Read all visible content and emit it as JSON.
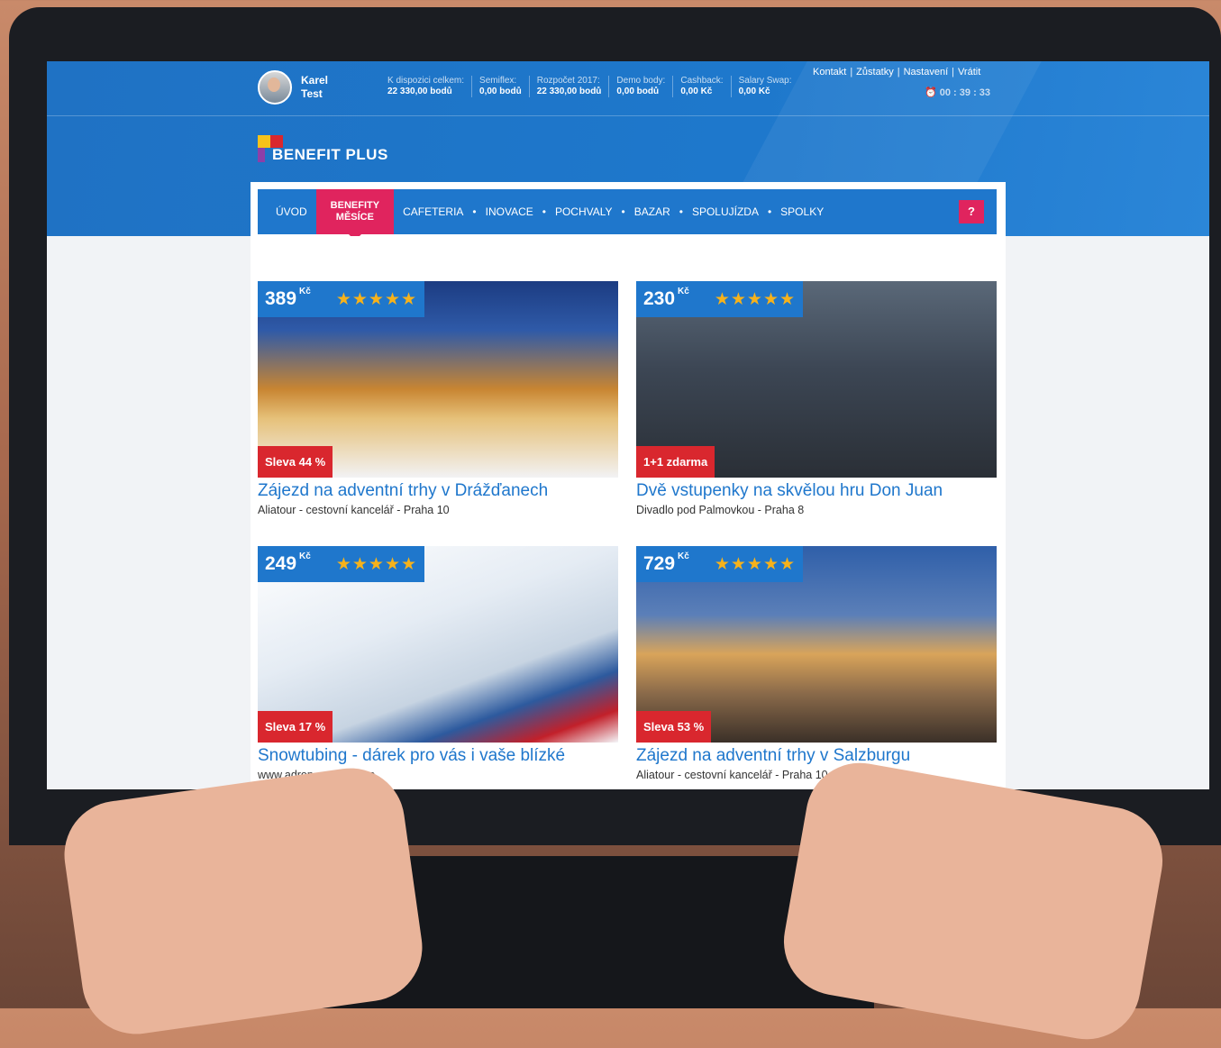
{
  "user": {
    "first_name": "Karel",
    "last_name": "Test"
  },
  "stats": [
    {
      "label": "K dispozici celkem:",
      "value": "22 330,00 bodů"
    },
    {
      "label": "Semiflex:",
      "value": "0,00 bodů"
    },
    {
      "label": "Rozpočet 2017:",
      "value": "22 330,00 bodů"
    },
    {
      "label": "Demo body:",
      "value": "0,00 bodů"
    },
    {
      "label": "Cashback:",
      "value": "0,00 Kč"
    },
    {
      "label": "Salary Swap:",
      "value": "0,00 Kč"
    }
  ],
  "top_links": [
    "Kontakt",
    "Zůstatky",
    "Nastavení",
    "Vrátit"
  ],
  "timer": "00 : 39 : 33",
  "logo": {
    "text": "BENEFIT PLUS",
    "colors": [
      "#f6c21b",
      "#d9272e",
      "#1f77cc"
    ]
  },
  "nav": {
    "items": [
      "ÚVOD",
      "BENEFITY MĚSÍCE",
      "CAFETERIA",
      "INOVACE",
      "POCHVALY",
      "BAZAR",
      "SPOLUJÍZDA",
      "SPOLKY"
    ],
    "active_line1": "BENEFITY",
    "active_line2": "MĚSÍCE",
    "help": "?"
  },
  "cards": [
    {
      "price": "389",
      "currency": "Kč",
      "stars": "★★★★★",
      "badge": "Sleva 44 %",
      "title": "Zájezd na adventní trhy v Drážďanech",
      "subtitle": "Aliatour - cestovní kancelář - Praha 10"
    },
    {
      "price": "230",
      "currency": "Kč",
      "stars": "★★★★★",
      "badge": "1+1 zdarma",
      "title": "Dvě vstupenky na skvělou hru Don Juan",
      "subtitle": "Divadlo pod Palmovkou - Praha 8"
    },
    {
      "price": "249",
      "currency": "Kč",
      "stars": "★★★★★",
      "badge": "Sleva 17 %",
      "title": "Snowtubing - dárek pro vás i vaše blízké",
      "subtitle": "www.adrop.cz - Liberec"
    },
    {
      "price": "729",
      "currency": "Kč",
      "stars": "★★★★★",
      "badge": "Sleva 53 %",
      "title": "Zájezd na adventní trhy v Salzburgu",
      "subtitle": "Aliatour - cestovní kancelář - Praha 10"
    }
  ],
  "colors": {
    "primary": "#1f77cc",
    "accent": "#e0245e",
    "discount": "#d9272e",
    "star": "#f6b21b"
  }
}
